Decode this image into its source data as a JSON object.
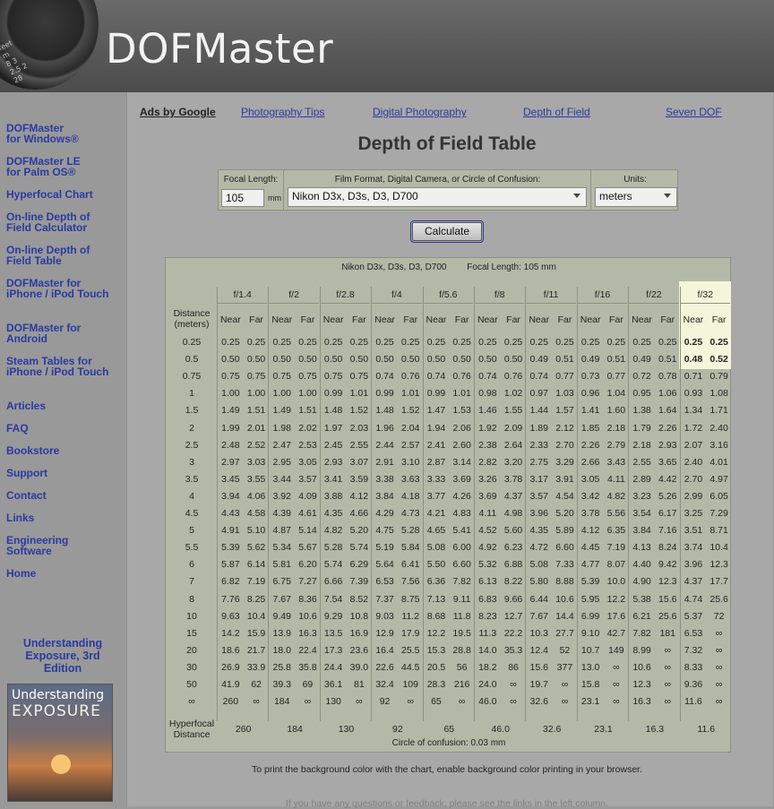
{
  "header": {
    "title": "DOFMaster",
    "lens_markings": [
      "feet",
      "m",
      "8  3",
      "2.5  2",
      "28"
    ]
  },
  "sidebar": {
    "items": [
      {
        "label": "DOFMaster\nfor Windows®"
      },
      {
        "label": "DOFMaster LE\nfor Palm OS®"
      },
      {
        "label": "Hyperfocal Chart"
      },
      {
        "label": "On-line Depth of\nField Calculator"
      },
      {
        "label": "On-line Depth of\nField Table"
      },
      {
        "label": "DOFMaster for\niPhone / iPod Touch"
      },
      {
        "label": "DOFMaster for\nAndroid"
      },
      {
        "label": "Steam Tables for\niPhone / iPod Touch"
      },
      {
        "label": "Articles"
      },
      {
        "label": "FAQ"
      },
      {
        "label": "Bookstore"
      },
      {
        "label": "Support"
      },
      {
        "label": "Contact"
      },
      {
        "label": "Links"
      },
      {
        "label": "Engineering\nSoftware"
      },
      {
        "label": "Home"
      }
    ],
    "promo": {
      "text": "Understanding Exposure, 3rd Edition",
      "book_title_top": "Understanding",
      "book_title_main": "EXPOSURE"
    }
  },
  "ads": {
    "label": "Ads by Google",
    "links": [
      "Photography Tips",
      "Digital Photography",
      "Depth of Field",
      "Seven DOF"
    ]
  },
  "page_title": "Depth of Field Table",
  "form": {
    "focal_label": "Focal Length:",
    "focal_value": "105",
    "focal_unit": "mm",
    "format_label": "Film Format, Digital Camera, or Circle of Confusion:",
    "format_value": "Nikon D3x, D3s, D3, D700",
    "units_label": "Units:",
    "units_value": "meters",
    "calculate_label": "Calculate"
  },
  "table": {
    "header_camera": "Nikon D3x, D3s, D3, D700",
    "header_focal": "Focal Length: 105 mm",
    "distance_label": "Distance\n(meters)",
    "near_label": "Near",
    "far_label": "Far",
    "hyperfocal_label": "Hyperfocal\nDistance",
    "apertures": [
      "f/1.4",
      "f/2",
      "f/2.8",
      "f/4",
      "f/5.6",
      "f/8",
      "f/11",
      "f/16",
      "f/22",
      "f/32"
    ],
    "highlight_aperture": "f/32",
    "highlight_rows": 2,
    "distances": [
      "0.25",
      "0.5",
      "0.75",
      "1",
      "1.5",
      "2",
      "2.5",
      "3",
      "3.5",
      "4",
      "4.5",
      "5",
      "5.5",
      "6",
      "7",
      "8",
      "10",
      "15",
      "20",
      "30",
      "50",
      "∞"
    ],
    "rows": [
      [
        "0.25",
        "0.25",
        "0.25",
        "0.25",
        "0.25",
        "0.25",
        "0.25",
        "0.25",
        "0.25",
        "0.25",
        "0.25",
        "0.25",
        "0.25",
        "0.25",
        "0.25",
        "0.25",
        "0.25",
        "0.25",
        "0.25",
        "0.25"
      ],
      [
        "0.50",
        "0.50",
        "0.50",
        "0.50",
        "0.50",
        "0.50",
        "0.50",
        "0.50",
        "0.50",
        "0.50",
        "0.50",
        "0.50",
        "0.49",
        "0.51",
        "0.49",
        "0.51",
        "0.49",
        "0.51",
        "0.48",
        "0.52"
      ],
      [
        "0.75",
        "0.75",
        "0.75",
        "0.75",
        "0.75",
        "0.75",
        "0.74",
        "0.76",
        "0.74",
        "0.76",
        "0.74",
        "0.76",
        "0.74",
        "0.77",
        "0.73",
        "0.77",
        "0.72",
        "0.78",
        "0.71",
        "0.79"
      ],
      [
        "1.00",
        "1.00",
        "1.00",
        "1.00",
        "0.99",
        "1.01",
        "0.99",
        "1.01",
        "0.99",
        "1.01",
        "0.98",
        "1.02",
        "0.97",
        "1.03",
        "0.96",
        "1.04",
        "0.95",
        "1.06",
        "0.93",
        "1.08"
      ],
      [
        "1.49",
        "1.51",
        "1.49",
        "1.51",
        "1.48",
        "1.52",
        "1.48",
        "1.52",
        "1.47",
        "1.53",
        "1.46",
        "1.55",
        "1.44",
        "1.57",
        "1.41",
        "1.60",
        "1.38",
        "1.64",
        "1.34",
        "1.71"
      ],
      [
        "1.99",
        "2.01",
        "1.98",
        "2.02",
        "1.97",
        "2.03",
        "1.96",
        "2.04",
        "1.94",
        "2.06",
        "1.92",
        "2.09",
        "1.89",
        "2.12",
        "1.85",
        "2.18",
        "1.79",
        "2.26",
        "1.72",
        "2.40"
      ],
      [
        "2.48",
        "2.52",
        "2.47",
        "2.53",
        "2.45",
        "2.55",
        "2.44",
        "2.57",
        "2.41",
        "2.60",
        "2.38",
        "2.64",
        "2.33",
        "2.70",
        "2.26",
        "2.79",
        "2.18",
        "2.93",
        "2.07",
        "3.16"
      ],
      [
        "2.97",
        "3.03",
        "2.95",
        "3.05",
        "2.93",
        "3.07",
        "2.91",
        "3.10",
        "2.87",
        "3.14",
        "2.82",
        "3.20",
        "2.75",
        "3.29",
        "2.66",
        "3.43",
        "2.55",
        "3.65",
        "2.40",
        "4.01"
      ],
      [
        "3.45",
        "3.55",
        "3.44",
        "3.57",
        "3.41",
        "3.59",
        "3.38",
        "3.63",
        "3.33",
        "3.69",
        "3.26",
        "3.78",
        "3.17",
        "3.91",
        "3.05",
        "4.11",
        "2.89",
        "4.42",
        "2.70",
        "4.97"
      ],
      [
        "3.94",
        "4.06",
        "3.92",
        "4.09",
        "3.88",
        "4.12",
        "3.84",
        "4.18",
        "3.77",
        "4.26",
        "3.69",
        "4.37",
        "3.57",
        "4.54",
        "3.42",
        "4.82",
        "3.23",
        "5.26",
        "2.99",
        "6.05"
      ],
      [
        "4.43",
        "4.58",
        "4.39",
        "4.61",
        "4.35",
        "4.66",
        "4.29",
        "4.73",
        "4.21",
        "4.83",
        "4.11",
        "4.98",
        "3.96",
        "5.20",
        "3.78",
        "5.56",
        "3.54",
        "6.17",
        "3.25",
        "7.29"
      ],
      [
        "4.91",
        "5.10",
        "4.87",
        "5.14",
        "4.82",
        "5.20",
        "4.75",
        "5.28",
        "4.65",
        "5.41",
        "4.52",
        "5.60",
        "4.35",
        "5.89",
        "4.12",
        "6.35",
        "3.84",
        "7.16",
        "3.51",
        "8.71"
      ],
      [
        "5.39",
        "5.62",
        "5.34",
        "5.67",
        "5.28",
        "5.74",
        "5.19",
        "5.84",
        "5.08",
        "6.00",
        "4.92",
        "6.23",
        "4.72",
        "6.60",
        "4.45",
        "7.19",
        "4.13",
        "8.24",
        "3.74",
        "10.4"
      ],
      [
        "5.87",
        "6.14",
        "5.81",
        "6.20",
        "5.74",
        "6.29",
        "5.64",
        "6.41",
        "5.50",
        "6.60",
        "5.32",
        "6.88",
        "5.08",
        "7.33",
        "4.77",
        "8.07",
        "4.40",
        "9.42",
        "3.96",
        "12.3"
      ],
      [
        "6.82",
        "7.19",
        "6.75",
        "7.27",
        "6.66",
        "7.39",
        "6.53",
        "7.56",
        "6.36",
        "7.82",
        "6.13",
        "8.22",
        "5.80",
        "8.88",
        "5.39",
        "10.0",
        "4.90",
        "12.3",
        "4.37",
        "17.7"
      ],
      [
        "7.76",
        "8.25",
        "7.67",
        "8.36",
        "7.54",
        "8.52",
        "7.37",
        "8.75",
        "7.13",
        "9.11",
        "6.83",
        "9.66",
        "6.44",
        "10.6",
        "5.95",
        "12.2",
        "5.38",
        "15.6",
        "4.74",
        "25.6"
      ],
      [
        "9.63",
        "10.4",
        "9.49",
        "10.6",
        "9.29",
        "10.8",
        "9.03",
        "11.2",
        "8.68",
        "11.8",
        "8.23",
        "12.7",
        "7.67",
        "14.4",
        "6.99",
        "17.6",
        "6.21",
        "25.6",
        "5.37",
        "72"
      ],
      [
        "14.2",
        "15.9",
        "13.9",
        "16.3",
        "13.5",
        "16.9",
        "12.9",
        "17.9",
        "12.2",
        "19.5",
        "11.3",
        "22.2",
        "10.3",
        "27.7",
        "9.10",
        "42.7",
        "7.82",
        "181",
        "6.53",
        "∞"
      ],
      [
        "18.6",
        "21.7",
        "18.0",
        "22.4",
        "17.3",
        "23.6",
        "16.4",
        "25.5",
        "15.3",
        "28.8",
        "14.0",
        "35.3",
        "12.4",
        "52",
        "10.7",
        "149",
        "8.99",
        "∞",
        "7.32",
        "∞"
      ],
      [
        "26.9",
        "33.9",
        "25.8",
        "35.8",
        "24.4",
        "39.0",
        "22.6",
        "44.5",
        "20.5",
        "56",
        "18.2",
        "86",
        "15.6",
        "377",
        "13.0",
        "∞",
        "10.6",
        "∞",
        "8.33",
        "∞"
      ],
      [
        "41.9",
        "62",
        "39.3",
        "69",
        "36.1",
        "81",
        "32.4",
        "109",
        "28.3",
        "216",
        "24.0",
        "∞",
        "19.7",
        "∞",
        "15.8",
        "∞",
        "12.3",
        "∞",
        "9.36",
        "∞"
      ],
      [
        "260",
        "∞",
        "184",
        "∞",
        "130",
        "∞",
        "92",
        "∞",
        "65",
        "∞",
        "46.0",
        "∞",
        "32.6",
        "∞",
        "23.1",
        "∞",
        "16.3",
        "∞",
        "11.6",
        "∞"
      ]
    ],
    "hyperfocal": [
      "260",
      "184",
      "130",
      "92",
      "65",
      "46.0",
      "32.6",
      "23.1",
      "16.3",
      "11.6"
    ],
    "footer": "Circle of confusion: 0.03 mm"
  },
  "notes": {
    "print": "To print the background color with the chart, enable background color printing in your browser.",
    "bottom": "If you have any questions or feedback, please see the links in the left column."
  },
  "colors": {
    "link": "#2a3aa0",
    "highlight": "#f3f6da",
    "panel": "#b4b8a6"
  }
}
